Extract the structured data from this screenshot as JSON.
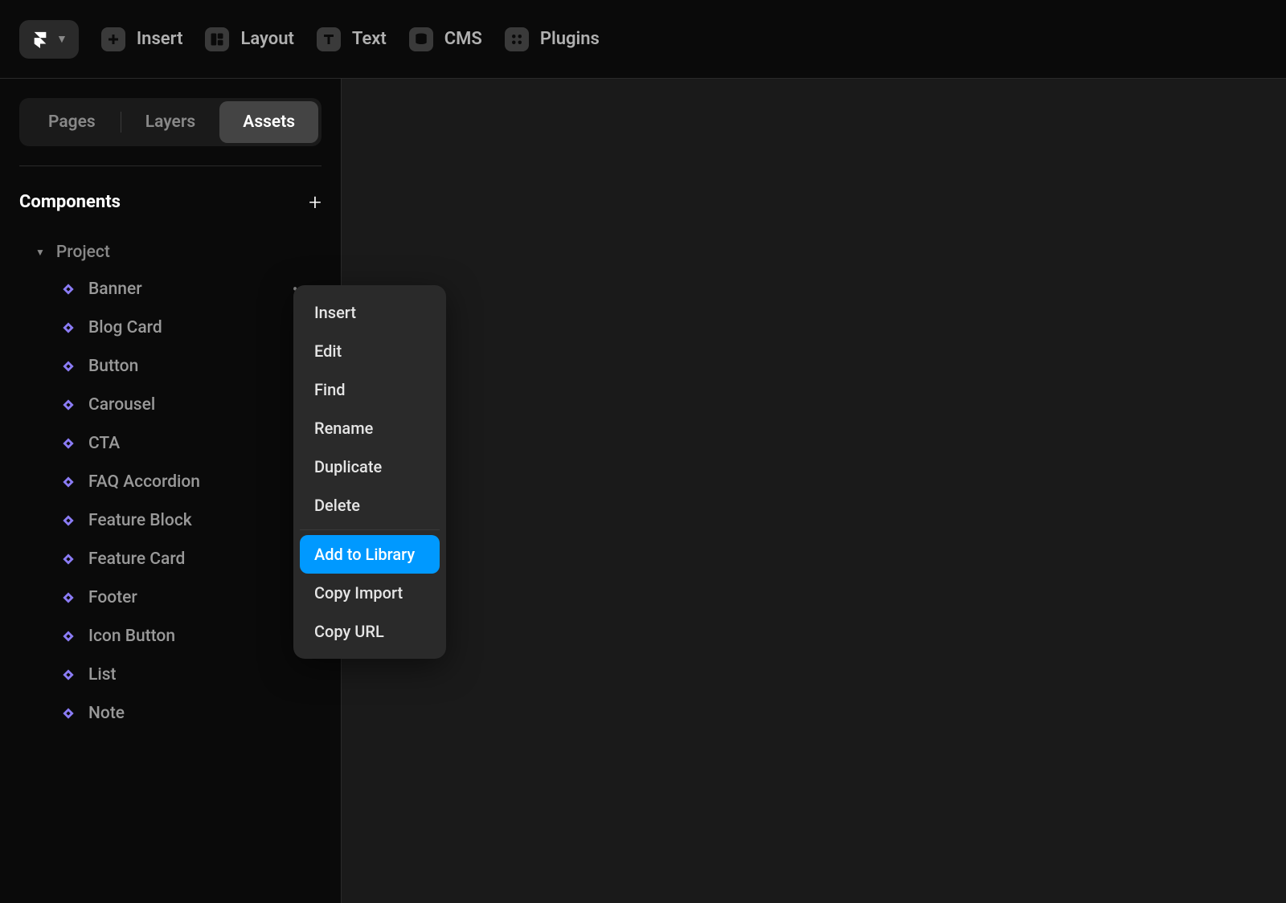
{
  "toolbar": {
    "items": [
      {
        "label": "Insert"
      },
      {
        "label": "Layout"
      },
      {
        "label": "Text"
      },
      {
        "label": "CMS"
      },
      {
        "label": "Plugins"
      }
    ]
  },
  "sidebar": {
    "tabs": [
      {
        "label": "Pages"
      },
      {
        "label": "Layers"
      },
      {
        "label": "Assets"
      }
    ],
    "section_title": "Components",
    "group_label": "Project",
    "components": [
      {
        "label": "Banner"
      },
      {
        "label": "Blog Card"
      },
      {
        "label": "Button"
      },
      {
        "label": "Carousel"
      },
      {
        "label": "CTA"
      },
      {
        "label": "FAQ Accordion"
      },
      {
        "label": "Feature Block"
      },
      {
        "label": "Feature Card"
      },
      {
        "label": "Footer"
      },
      {
        "label": "Icon Button"
      },
      {
        "label": "List"
      },
      {
        "label": "Note"
      }
    ]
  },
  "context_menu": {
    "items_top": [
      {
        "label": "Insert"
      },
      {
        "label": "Edit"
      },
      {
        "label": "Find"
      },
      {
        "label": "Rename"
      },
      {
        "label": "Duplicate"
      },
      {
        "label": "Delete"
      }
    ],
    "items_bottom": [
      {
        "label": "Add to Library"
      },
      {
        "label": "Copy Import"
      },
      {
        "label": "Copy URL"
      }
    ]
  }
}
